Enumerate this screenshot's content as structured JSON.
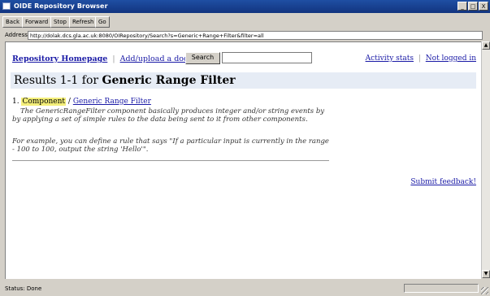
{
  "window": {
    "title": "OIDE Repository Browser",
    "controls": [
      "_",
      "□",
      "X"
    ]
  },
  "toolbar": {
    "back_label": "Back",
    "forward_label": "Forward",
    "stop_label": "Stop",
    "refresh_label": "Refresh",
    "go_label": "Go"
  },
  "address": {
    "label": "Address",
    "url": "http://dolak.dcs.gla.ac.uk:8080/OIRepository/Search?s=Generic+Range+Filter&filter=all"
  },
  "page": {
    "nav": {
      "home_link": "Repository Homepage",
      "separator": "|",
      "upload_link": "Add/upload a document",
      "search_button": "Search",
      "search_value": ""
    },
    "right_nav": {
      "activity_link": "Activity stats",
      "separator": "|",
      "login_link": "Not logged in"
    },
    "results": {
      "prefix": "Results 1-1 for",
      "query": "Generic Range Filter"
    },
    "item": {
      "index": "1.",
      "type": "Component",
      "slash": "/",
      "title": "Generic Range Filter",
      "description_1": "The GenericRangeFilter component basically produces integer and/or string events by by applying a set of simple rules to the data being sent to it from other components.",
      "description_2": "For example, you can define a rule that says \"If a particular input is currently in the range - 100 to 100, output the string 'Hello'\"."
    },
    "feedback_link": "Submit feedback!"
  },
  "status": {
    "text": "Status: Done"
  }
}
